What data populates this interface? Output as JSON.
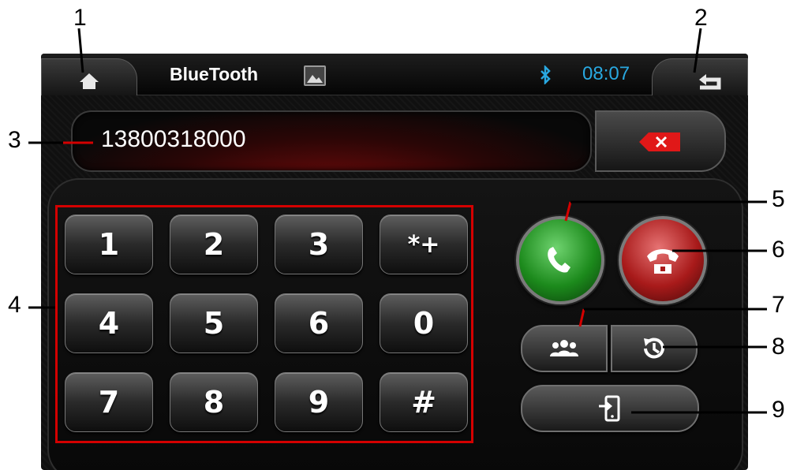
{
  "callouts": [
    "1",
    "2",
    "3",
    "4",
    "5",
    "6",
    "7",
    "8",
    "9"
  ],
  "header": {
    "title": "BlueTooth",
    "time": "08:07",
    "icons": {
      "home": "home-icon",
      "back": "back-arrow-icon",
      "image": "image-icon",
      "bluetooth": "bluetooth-icon"
    }
  },
  "display": {
    "number": "13800318000",
    "delete_icon": "backspace-icon"
  },
  "keypad": {
    "keys": [
      "1",
      "2",
      "3",
      "*+",
      "4",
      "5",
      "6",
      "0",
      "7",
      "8",
      "9",
      "#"
    ]
  },
  "actions": {
    "call_icon": "phone-call-icon",
    "hangup_icon": "phone-hangup-icon",
    "contacts_icon": "contacts-icon",
    "history_icon": "call-history-icon",
    "transfer_icon": "phone-transfer-icon"
  },
  "colors": {
    "accent_blue": "#29a8e0",
    "call_green": "#1c8a1c",
    "hangup_red": "#a81a1a",
    "annotation_red": "#d40000"
  }
}
